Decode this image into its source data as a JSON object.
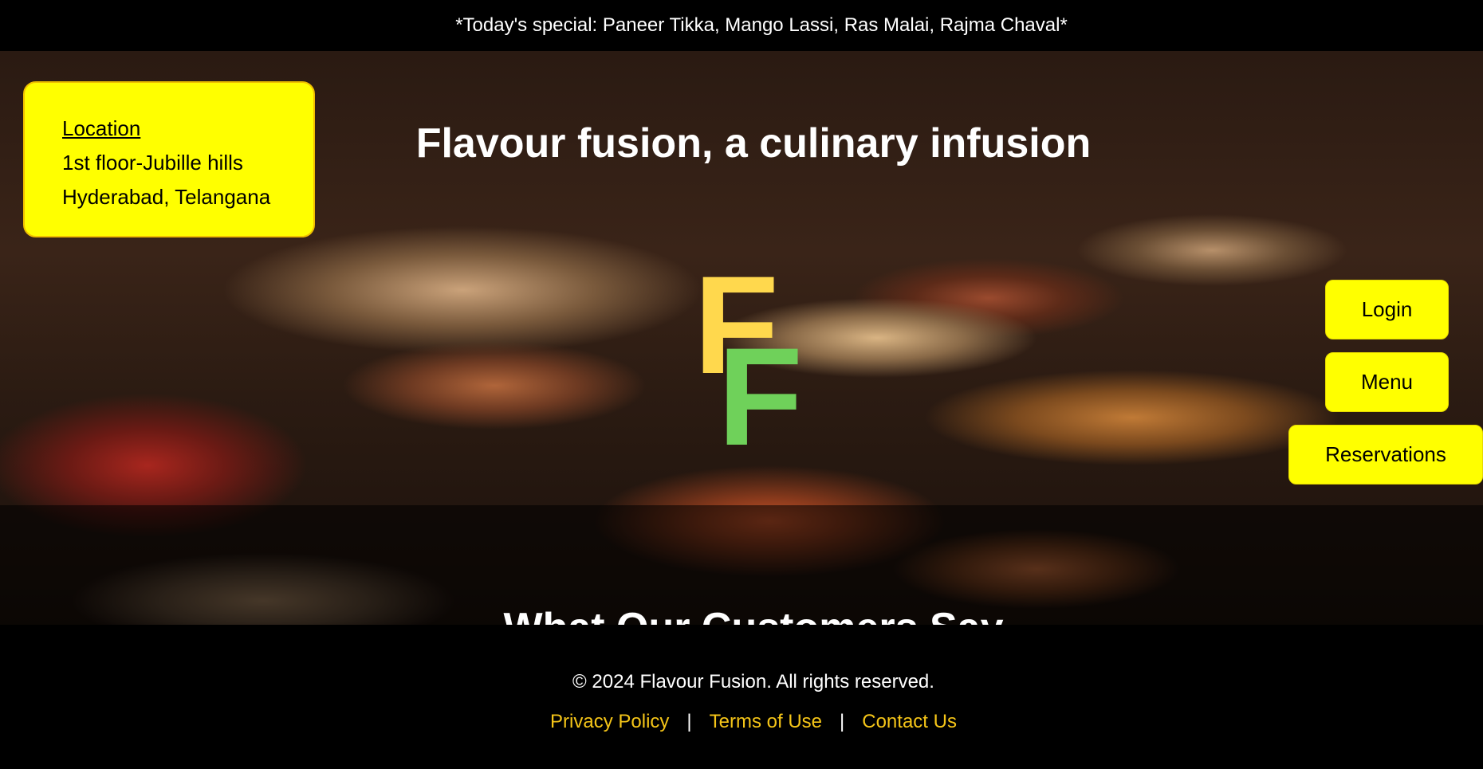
{
  "topbar": {
    "special": "*Today's special: Paneer Tikka, Mango Lassi, Ras Malai, Rajma Chaval*"
  },
  "location": {
    "title": "Location",
    "line1": "1st floor-Jubille hills",
    "line2": "Hyderabad, Telangana"
  },
  "hero": {
    "title": "Flavour fusion, a culinary infusion",
    "logo": {
      "letter1": "F",
      "letter2": "F",
      "color1": "#ffd84d",
      "color2": "#6fd15a"
    }
  },
  "nav": {
    "login": "Login",
    "menu": "Menu",
    "reservations": "Reservations"
  },
  "testimonials": {
    "heading": "What Our Customers Say"
  },
  "footer": {
    "copyright": "© 2024 Flavour Fusion. All rights reserved.",
    "links": [
      "Privacy Policy",
      "Terms of Use",
      "Contact Us"
    ],
    "separator": "|"
  },
  "colors": {
    "accent": "#ffff00",
    "link": "#f5c518",
    "background": "#000000"
  }
}
